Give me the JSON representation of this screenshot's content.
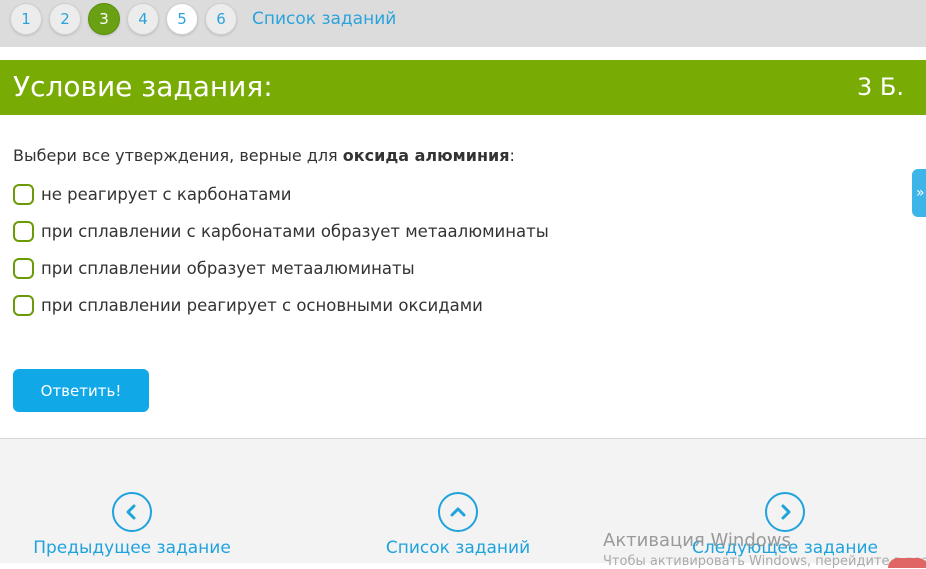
{
  "pager": {
    "pages": [
      "1",
      "2",
      "3",
      "4",
      "5",
      "6"
    ],
    "current": "3",
    "list_link": "Список заданий"
  },
  "header": {
    "title": "Условие задания:",
    "score": "3 Б."
  },
  "question": {
    "prefix": "Выбери все утверждения, верные для ",
    "bold": "оксида алюминия",
    "suffix": ":"
  },
  "options": [
    "не реагирует с карбонатами",
    "при сплавлении с карбонатами образует метаалюминаты",
    "при сплавлении образует метаалюминаты",
    "при сплавлении реагирует с основными оксидами"
  ],
  "answer_button": "Ответить!",
  "footer": {
    "prev": "Предыдущее задание",
    "list": "Список заданий",
    "next": "Следующее задание"
  },
  "watermark": {
    "title": "Активация Windows",
    "subtitle": "Чтобы активировать Windows, перейдите в раздел"
  },
  "colors": {
    "header_green": "#78ab04",
    "active_page": "#6aa013",
    "accent_blue": "#11a8e8",
    "link_blue": "#2aa3dc"
  },
  "icons": {
    "side_tab": "chevrons-right-icon",
    "prev": "chevron-left-icon",
    "list": "chevron-up-icon",
    "next": "chevron-right-icon"
  }
}
